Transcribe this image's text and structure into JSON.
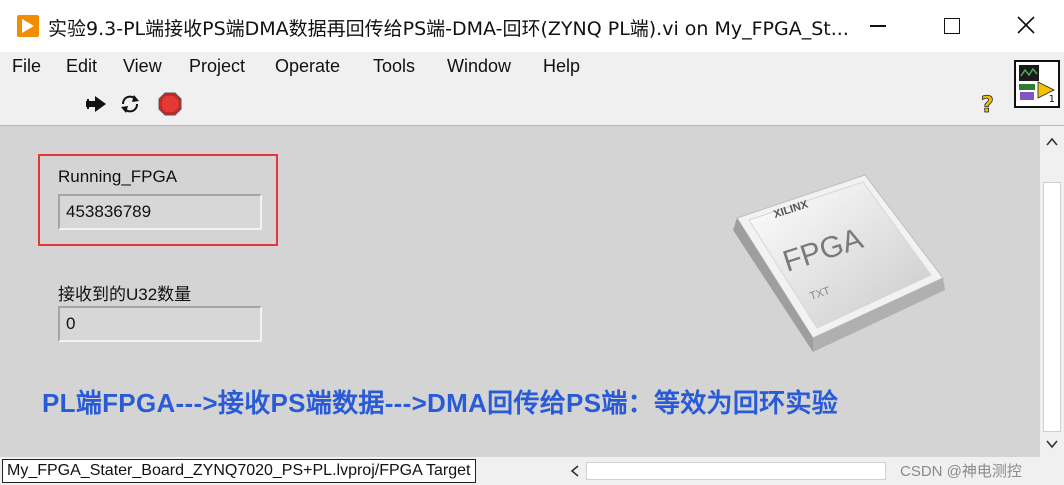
{
  "window": {
    "title": "实验9.3-PL端接收PS端DMA数据再回传给PS端-DMA-回环(ZYNQ PL端).vi on My_FPGA_St..."
  },
  "menu": [
    "File",
    "Edit",
    "View",
    "Project",
    "Operate",
    "Tools",
    "Window",
    "Help"
  ],
  "toolbar": {
    "run_icon": "run-arrow-icon",
    "run_continuous_icon": "run-continuously-icon",
    "abort_icon": "abort-stop-icon",
    "help_icon": "context-help-icon"
  },
  "vi_icon": {
    "number": "1"
  },
  "controls": {
    "running_fpga": {
      "label": "Running_FPGA",
      "value": "453836789"
    },
    "u32_count": {
      "label": "接收到的U32数量",
      "value": "0"
    }
  },
  "banner": "PL端FPGA--->接收PS端数据--->DMA回传给PS端：等效为回环实验",
  "chip": {
    "brand": "XILINX",
    "main": "FPGA",
    "sub": "TXT"
  },
  "status": {
    "path": "My_FPGA_Stater_Board_ZYNQ7020_PS+PL.lvproj/FPGA Target",
    "watermark": "CSDN @神电测控"
  },
  "colors": {
    "banner": "#2a5bd7",
    "highlight": "#e2383a",
    "panel": "#d4d4d4",
    "app_icon": "#f28c00"
  }
}
